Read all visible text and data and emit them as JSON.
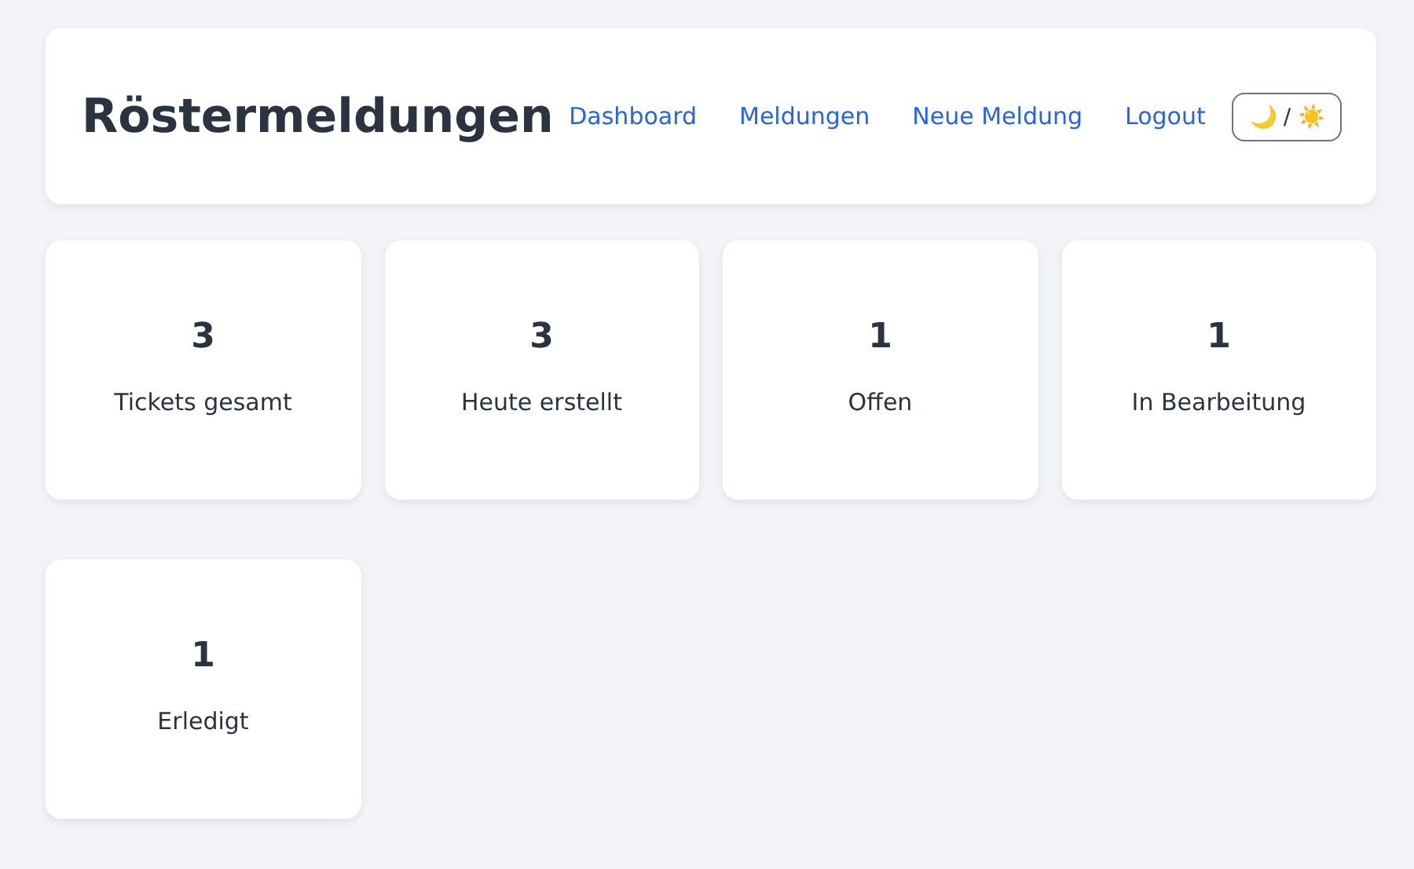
{
  "header": {
    "title": "Röstermeldungen",
    "nav": [
      {
        "label": "Dashboard"
      },
      {
        "label": "Meldungen"
      },
      {
        "label": "Neue Meldung"
      },
      {
        "label": "Logout"
      }
    ],
    "theme_toggle": "🌙 / ☀️"
  },
  "stats": [
    {
      "value": "3",
      "label": "Tickets gesamt"
    },
    {
      "value": "3",
      "label": "Heute erstellt"
    },
    {
      "value": "1",
      "label": "Offen"
    },
    {
      "value": "1",
      "label": "In Bearbeitung"
    },
    {
      "value": "1",
      "label": "Erledigt"
    }
  ]
}
